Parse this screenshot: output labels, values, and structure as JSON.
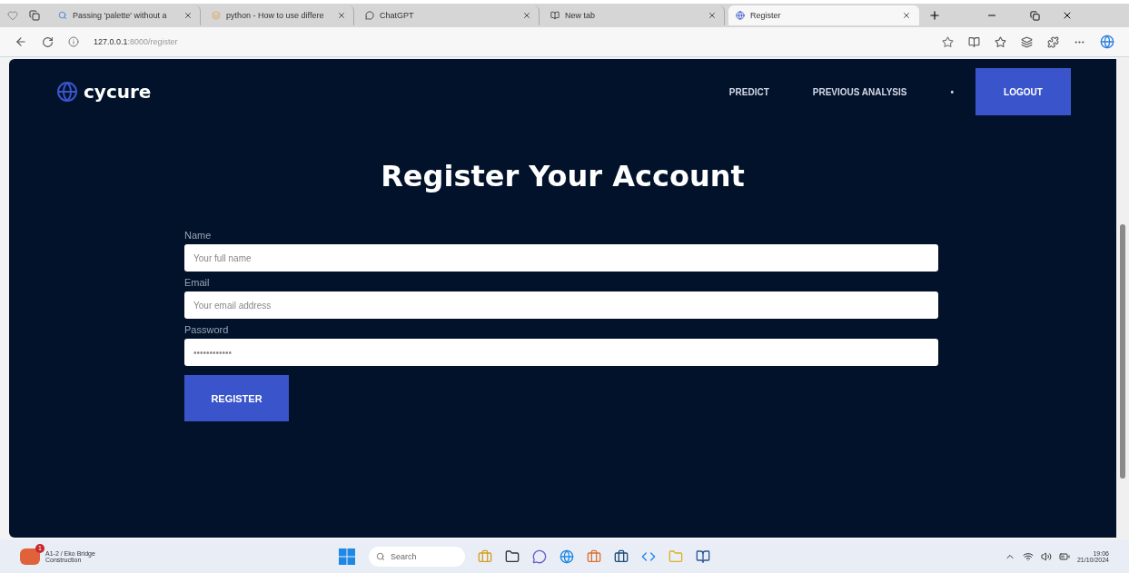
{
  "browser": {
    "tabs": [
      {
        "title": "Passing 'palette' without a",
        "selected": false
      },
      {
        "title": "python - How to use differe",
        "selected": false
      },
      {
        "title": "ChatGPT",
        "selected": false
      },
      {
        "title": "New tab",
        "selected": false
      },
      {
        "title": "Register",
        "selected": true
      }
    ],
    "url_host": "127.0.0.1",
    "url_path": ":8000/register"
  },
  "site": {
    "logo": "cycure",
    "nav": [
      {
        "label": "PREDICT",
        "kind": "link"
      },
      {
        "label": "PREVIOUS ANALYSIS",
        "kind": "link"
      },
      {
        "label": "•",
        "kind": "link"
      },
      {
        "label": "LOGOUT",
        "kind": "button"
      }
    ],
    "title": "Register Your Account",
    "fields": [
      {
        "label": "Name",
        "placeholder": "Your full name"
      },
      {
        "label": "Email",
        "placeholder": "Your email address"
      },
      {
        "label": "Password",
        "placeholder": "••••••••••••"
      }
    ],
    "submit": "REGISTER"
  },
  "taskbar": {
    "weather_title": "A1-2 / Eko Bridge",
    "weather_sub": "Construction",
    "badge": "1",
    "search": "Search",
    "time": "19:06",
    "date": "21/10/2024"
  }
}
